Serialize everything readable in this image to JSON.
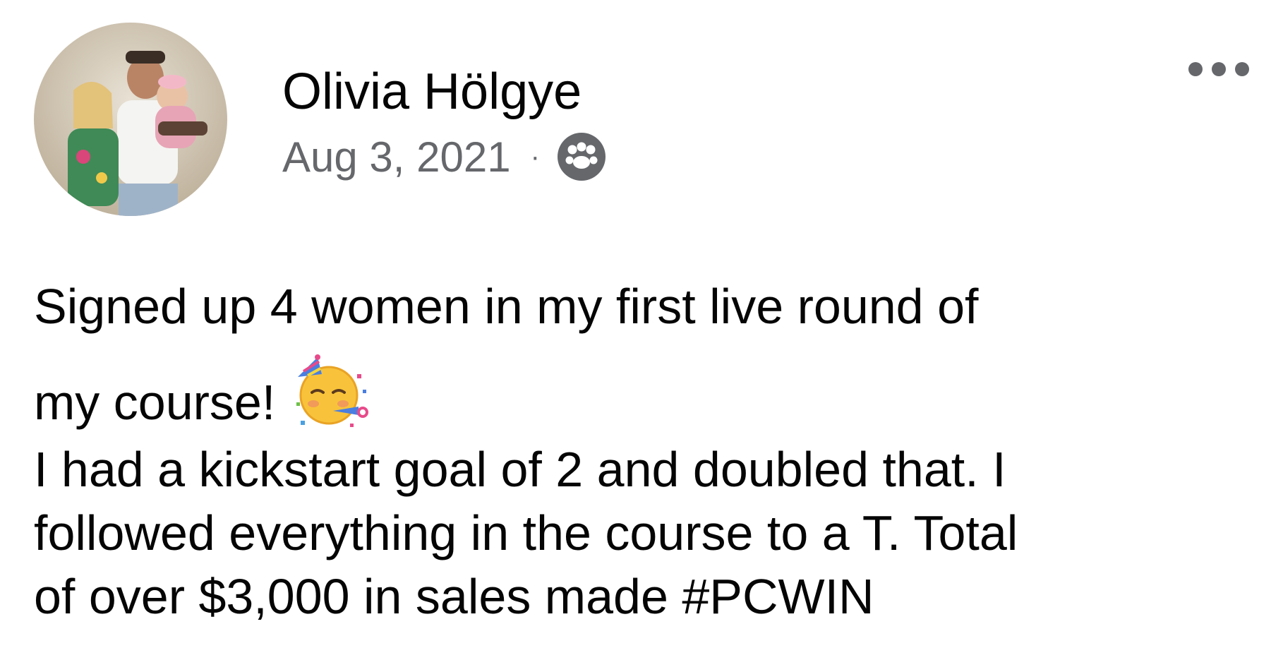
{
  "post": {
    "author": "Olivia Hölgye",
    "timestamp": "Aug 3, 2021",
    "separator": "·",
    "audience_icon": "group-members-icon",
    "more_icon": "more-options-icon",
    "text_line1": "Signed up 4 women in my first live round of",
    "text_line2": "my course!",
    "emoji": "partying-face-emoji",
    "text_para2_line1": "I had a kickstart goal of 2 and doubled that. I",
    "text_para2_line2": "followed everything in the course to a T. Total",
    "text_para2_line3_prefix": "of over $3,000 in sales made ",
    "hashtag": "#PCWIN"
  },
  "colors": {
    "primary_text": "#050505",
    "secondary_text": "#65676b",
    "background": "#ffffff"
  }
}
